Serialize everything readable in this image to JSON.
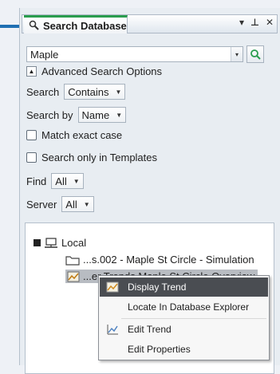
{
  "panel": {
    "tab_title": "Search Database",
    "tab_buttons": [
      "▾",
      "⊥",
      "✕"
    ]
  },
  "search": {
    "query_value": "Maple",
    "advanced_label": "Advanced Search Options"
  },
  "options": {
    "search_label": "Search",
    "search_mode": "Contains",
    "search_by_label": "Search by",
    "search_by_value": "Name",
    "match_case_label": "Match exact case",
    "templates_label": "Search only in Templates",
    "find_label": "Find",
    "find_value": "All",
    "server_label": "Server",
    "server_value": "All"
  },
  "tree": {
    "root_label": "Local",
    "item1_label": "...s.002 - Maple St Circle - Simulation",
    "item2_label": "...er Trends.Maple St Circle Overview"
  },
  "context_menu": {
    "items": [
      {
        "label": "Display Trend"
      },
      {
        "label": "Locate In Database Explorer"
      },
      {
        "label": "Edit Trend"
      },
      {
        "label": "Edit Properties"
      }
    ]
  },
  "colors": {
    "accent_green": "#2a9d4e",
    "accent_blue": "#1f6fb2",
    "menu_highlight": "#4a4d52",
    "selected_row": "#b8bcc2"
  }
}
